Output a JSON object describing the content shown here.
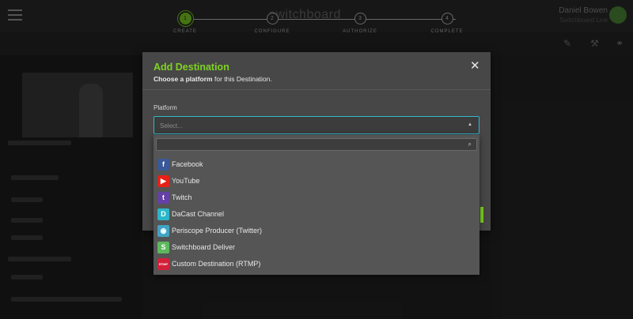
{
  "app": {
    "brand": "switchboard",
    "user_name": "Daniel Bowen",
    "user_subtitle": "Switchboard Live"
  },
  "steps": [
    {
      "number": "1",
      "label": "CREATE",
      "active": true
    },
    {
      "number": "2",
      "label": "CONFIGURE",
      "active": false
    },
    {
      "number": "3",
      "label": "AUTHORIZE",
      "active": false
    },
    {
      "number": "4",
      "label": "COMPLETE",
      "active": false
    }
  ],
  "modal": {
    "title": "Add Destination",
    "subtitle_bold": "Choose a platform",
    "subtitle_rest": " for this Destination.",
    "close_glyph": "✕",
    "field_label": "Platform",
    "select_placeholder": "Select...",
    "search_placeholder": ""
  },
  "platforms": [
    {
      "label": "Facebook",
      "icon": "facebook-icon",
      "glyph": "f",
      "color": "#3b5998"
    },
    {
      "label": "YouTube",
      "icon": "youtube-icon",
      "glyph": "▶",
      "color": "#e62117"
    },
    {
      "label": "Twitch",
      "icon": "twitch-icon",
      "glyph": "t",
      "color": "#6441a5"
    },
    {
      "label": "DaCast Channel",
      "icon": "dacast-icon",
      "glyph": "D",
      "color": "#2bb6c9"
    },
    {
      "label": "Periscope Producer (Twitter)",
      "icon": "periscope-icon",
      "glyph": "◉",
      "color": "#40a4c4"
    },
    {
      "label": "Switchboard Deliver",
      "icon": "switchboard-icon",
      "glyph": "S",
      "color": "#5cb85c"
    },
    {
      "label": "Custom Destination (RTMP)",
      "icon": "rtmp-icon",
      "glyph": "RTMP",
      "color": "#d3203a"
    }
  ]
}
